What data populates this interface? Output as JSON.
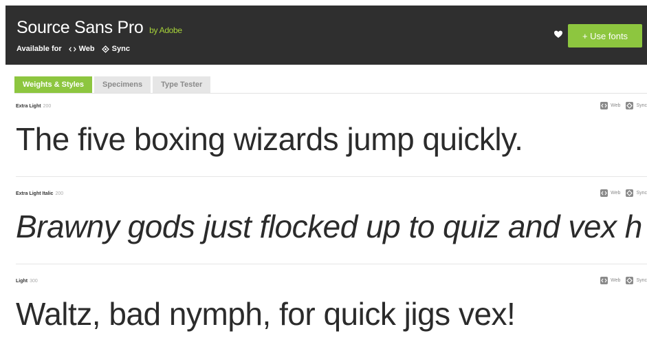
{
  "header": {
    "font_name": "Source Sans Pro",
    "by_word": "by",
    "foundry": "Adobe",
    "available_label": "Available for",
    "platforms": [
      "Web",
      "Sync"
    ],
    "use_fonts_label": "+ Use fonts",
    "accent_color": "#8dc63f",
    "background_color": "#2f2f2f"
  },
  "tabs": [
    {
      "label": "Weights & Styles",
      "active": true
    },
    {
      "label": "Specimens",
      "active": false
    },
    {
      "label": "Type Tester",
      "active": false
    }
  ],
  "rows": [
    {
      "style": "Extra Light",
      "weight": "200",
      "web": "Web",
      "sync": "Sync",
      "sample": "The five boxing wizards jump quickly."
    },
    {
      "style": "Extra Light Italic",
      "weight": "200",
      "web": "Web",
      "sync": "Sync",
      "sample": "Brawny gods just flocked up to quiz and vex h"
    },
    {
      "style": "Light",
      "weight": "300",
      "web": "Web",
      "sync": "Sync",
      "sample": "Waltz, bad nymph, for quick jigs vex!"
    }
  ]
}
